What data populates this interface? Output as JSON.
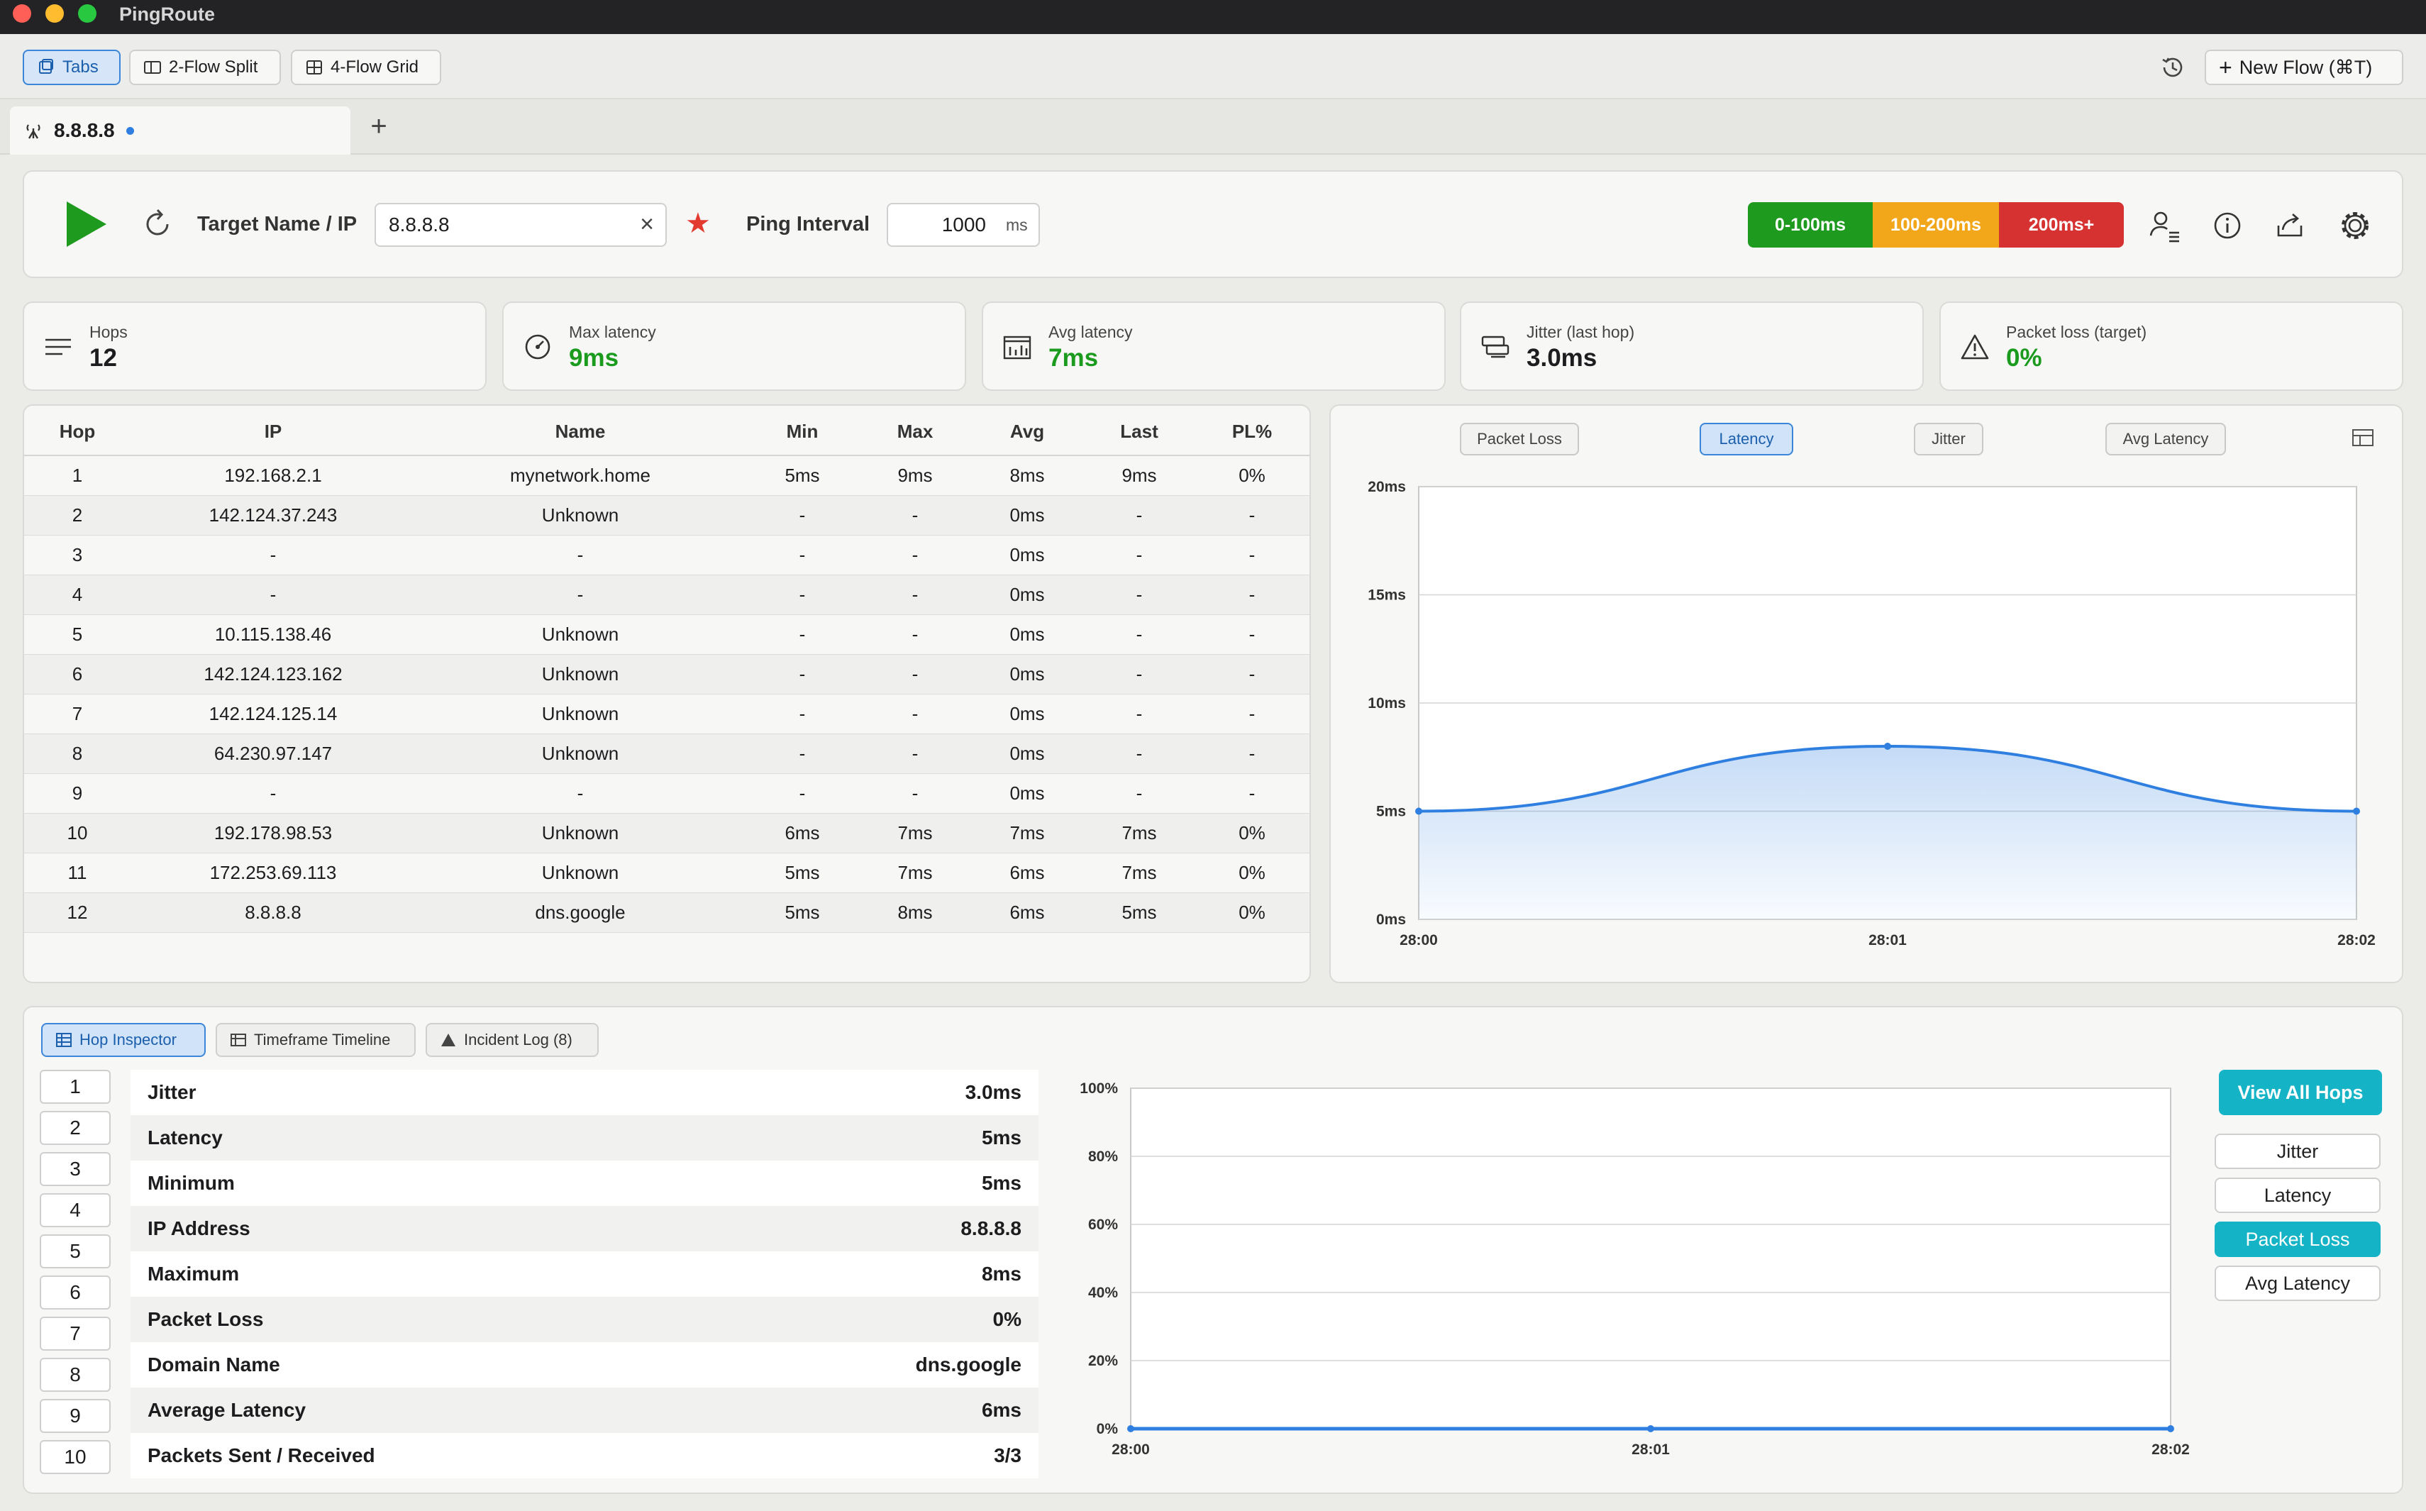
{
  "app": {
    "title": "PingRoute"
  },
  "toolbar": {
    "tabs_label": "Tabs",
    "split2_label": "2-Flow Split",
    "grid4_label": "4-Flow Grid",
    "new_flow_label": "New Flow (⌘T)"
  },
  "tab": {
    "label": "8.8.8.8"
  },
  "controls": {
    "target_label": "Target Name / IP",
    "target_value": "8.8.8.8",
    "interval_label": "Ping Interval",
    "interval_value": "1000",
    "interval_unit": "ms",
    "legend": [
      {
        "label": "0-100ms",
        "color": "#1e9b1e"
      },
      {
        "label": "100-200ms",
        "color": "#f2a61a"
      },
      {
        "label": "200ms+",
        "color": "#d63232"
      }
    ]
  },
  "stats": {
    "hops": {
      "label": "Hops",
      "value": "12"
    },
    "max_latency": {
      "label": "Max latency",
      "value": "9ms"
    },
    "avg_latency": {
      "label": "Avg latency",
      "value": "7ms"
    },
    "jitter": {
      "label": "Jitter (last hop)",
      "value": "3.0ms"
    },
    "packet_loss": {
      "label": "Packet loss (target)",
      "value": "0%"
    }
  },
  "hop_table": {
    "columns": [
      "Hop",
      "IP",
      "Name",
      "Min",
      "Max",
      "Avg",
      "Last",
      "PL%"
    ],
    "rows": [
      [
        "1",
        "192.168.2.1",
        "mynetwork.home",
        "5ms",
        "9ms",
        "8ms",
        "9ms",
        "0%"
      ],
      [
        "2",
        "142.124.37.243",
        "Unknown",
        "-",
        "-",
        "0ms",
        "-",
        "-"
      ],
      [
        "3",
        "-",
        "-",
        "-",
        "-",
        "0ms",
        "-",
        "-"
      ],
      [
        "4",
        "-",
        "-",
        "-",
        "-",
        "0ms",
        "-",
        "-"
      ],
      [
        "5",
        "10.115.138.46",
        "Unknown",
        "-",
        "-",
        "0ms",
        "-",
        "-"
      ],
      [
        "6",
        "142.124.123.162",
        "Unknown",
        "-",
        "-",
        "0ms",
        "-",
        "-"
      ],
      [
        "7",
        "142.124.125.14",
        "Unknown",
        "-",
        "-",
        "0ms",
        "-",
        "-"
      ],
      [
        "8",
        "64.230.97.147",
        "Unknown",
        "-",
        "-",
        "0ms",
        "-",
        "-"
      ],
      [
        "9",
        "-",
        "-",
        "-",
        "-",
        "0ms",
        "-",
        "-"
      ],
      [
        "10",
        "192.178.98.53",
        "Unknown",
        "6ms",
        "7ms",
        "7ms",
        "7ms",
        "0%"
      ],
      [
        "11",
        "172.253.69.113",
        "Unknown",
        "5ms",
        "7ms",
        "6ms",
        "7ms",
        "0%"
      ],
      [
        "12",
        "8.8.8.8",
        "dns.google",
        "5ms",
        "8ms",
        "6ms",
        "5ms",
        "0%"
      ]
    ]
  },
  "chart_tabs": [
    "Packet Loss",
    "Latency",
    "Jitter",
    "Avg Latency"
  ],
  "chart_data": [
    {
      "type": "area",
      "x": [
        "28:00",
        "28:01",
        "28:02"
      ],
      "values": [
        5,
        8,
        5
      ],
      "y_ticks": [
        "0ms",
        "5ms",
        "10ms",
        "15ms",
        "20ms"
      ],
      "ylim": [
        0,
        20
      ],
      "color": "#2f7fe0"
    },
    {
      "type": "line",
      "x": [
        "28:00",
        "28:01",
        "28:02"
      ],
      "values": [
        0,
        0,
        0
      ],
      "y_ticks": [
        "0%",
        "20%",
        "40%",
        "60%",
        "80%",
        "100%"
      ],
      "ylim": [
        0,
        100
      ],
      "color": "#2f7fe0"
    }
  ],
  "bottom_tabs": {
    "hop_inspector": "Hop Inspector",
    "timeline": "Timeframe Timeline",
    "incident_log": "Incident Log (8)"
  },
  "hop_list": [
    "1",
    "2",
    "3",
    "4",
    "5",
    "6",
    "7",
    "8",
    "9",
    "10"
  ],
  "inspector": [
    {
      "label": "Jitter",
      "value": "3.0ms"
    },
    {
      "label": "Latency",
      "value": "5ms"
    },
    {
      "label": "Minimum",
      "value": "5ms"
    },
    {
      "label": "IP Address",
      "value": "8.8.8.8"
    },
    {
      "label": "Maximum",
      "value": "8ms"
    },
    {
      "label": "Packet Loss",
      "value": "0%"
    },
    {
      "label": "Domain Name",
      "value": "dns.google"
    },
    {
      "label": "Average Latency",
      "value": "6ms"
    },
    {
      "label": "Packets Sent / Received",
      "value": "3/3"
    }
  ],
  "right_buttons": {
    "view_all": "View All Hops",
    "metrics": [
      "Jitter",
      "Latency",
      "Packet Loss",
      "Avg Latency"
    ]
  }
}
